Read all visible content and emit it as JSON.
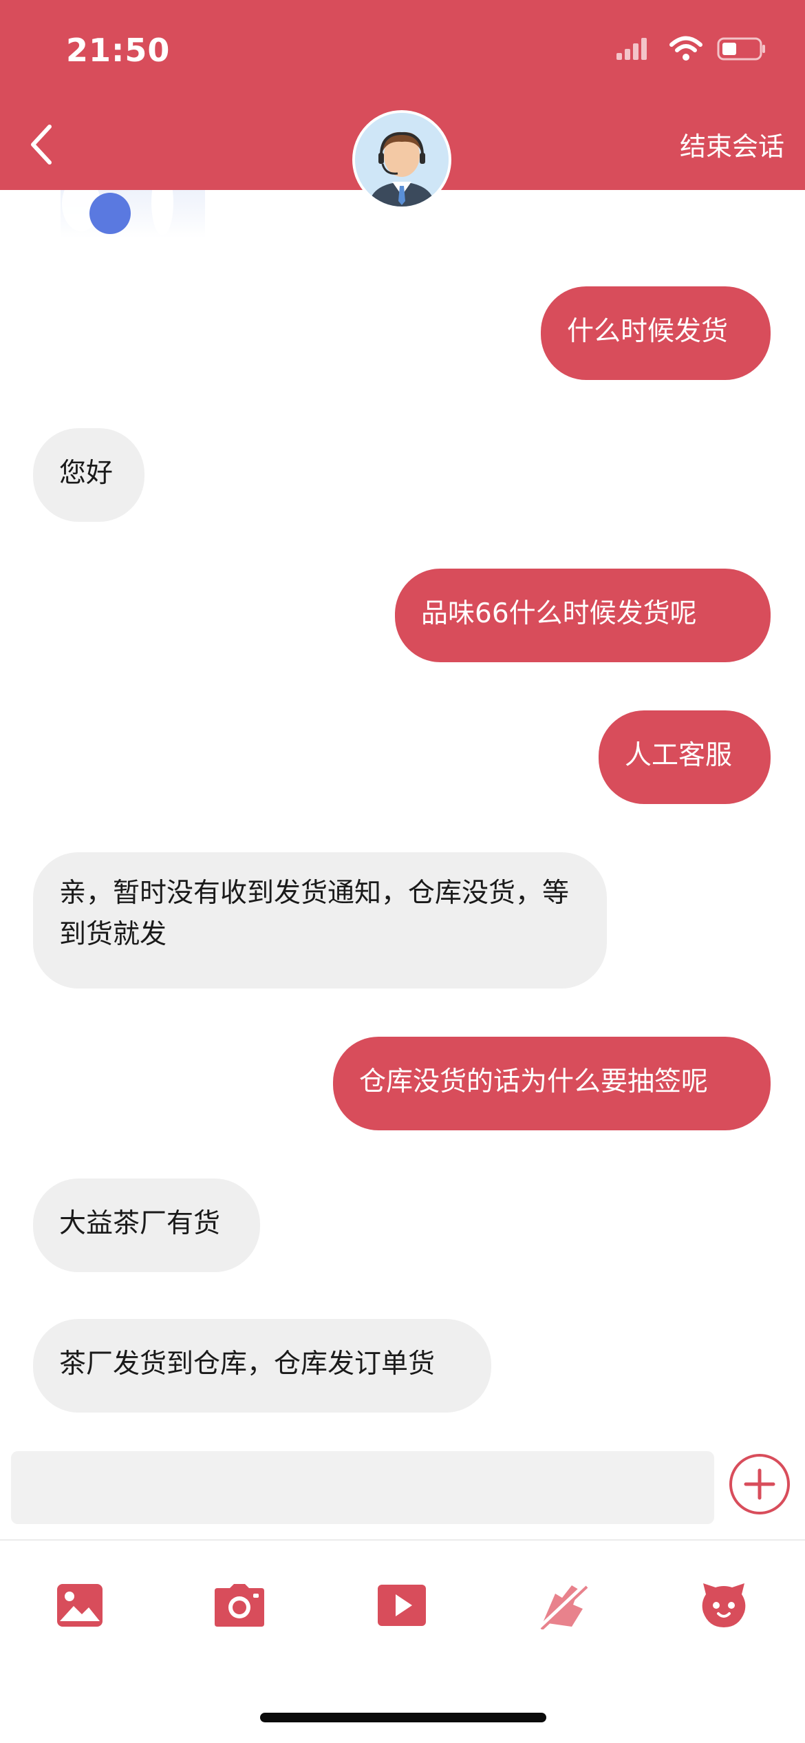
{
  "status_bar": {
    "time": "21:50"
  },
  "header": {
    "end_session_label": "结束会话"
  },
  "messages": [
    {
      "side": "out",
      "text": "什么时候发货"
    },
    {
      "side": "in",
      "text": "您好"
    },
    {
      "side": "out",
      "text": "品味66什么时候发货呢"
    },
    {
      "side": "out",
      "text": "人工客服"
    },
    {
      "side": "in",
      "text": "亲，暂时没有收到发货通知，仓库没货，等到货就发"
    },
    {
      "side": "out",
      "text": "仓库没货的话为什么要抽签呢"
    },
    {
      "side": "in",
      "text": "大益茶厂有货"
    },
    {
      "side": "in",
      "text": "茶厂发货到仓库，仓库发订单货"
    }
  ],
  "input": {
    "value": ""
  },
  "toolbar": {
    "icons": [
      "image-icon",
      "camera-icon",
      "video-icon",
      "order-icon",
      "emoji-icon"
    ]
  },
  "colors": {
    "brand": "#d84d5b",
    "incoming_bubble": "#efefef",
    "input_bg": "#f1f1f1"
  }
}
